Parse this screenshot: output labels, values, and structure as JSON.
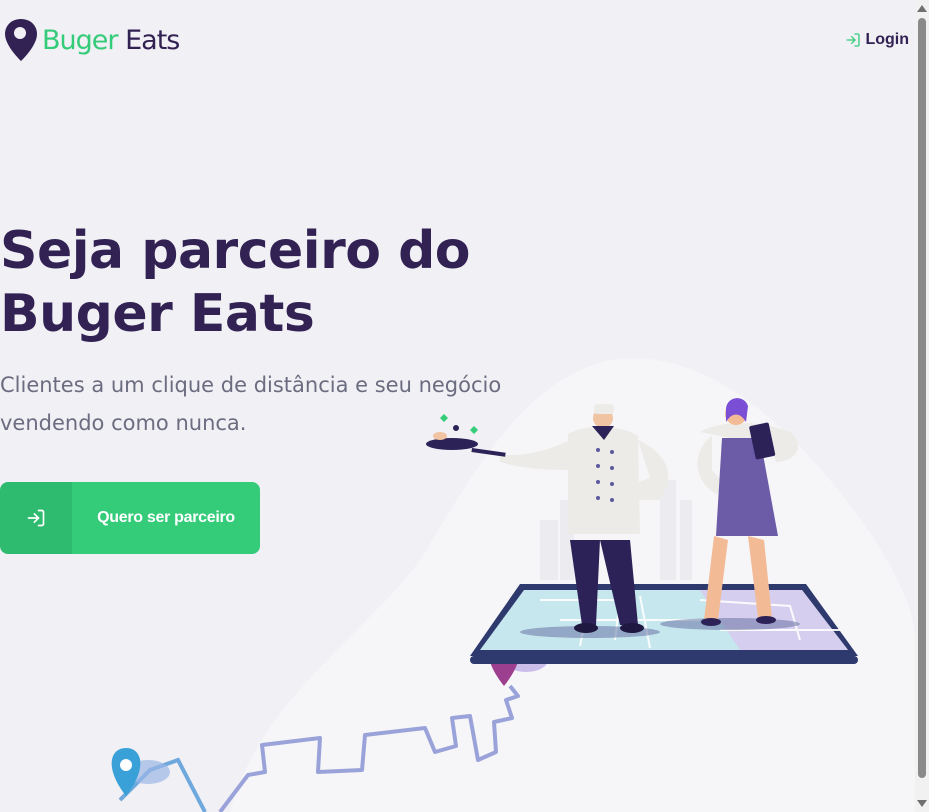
{
  "header": {
    "logo_word1": "Buger",
    "logo_word2": "Eats",
    "login_label": "Login"
  },
  "hero": {
    "title_line1": "Seja parceiro do",
    "title_line2": "Buger Eats",
    "subtitle_line1": "Clientes a um clique de distância e seu negócio",
    "subtitle_line2": "vendendo como nunca.",
    "cta_label": "Quero ser parceiro"
  },
  "icons": {
    "logo": "map-pin-icon",
    "login": "log-in-icon",
    "cta": "log-in-icon"
  },
  "colors": {
    "primary": "#34cb79",
    "title": "#322153",
    "text": "#6c6c80",
    "background": "#f0f0f5"
  }
}
